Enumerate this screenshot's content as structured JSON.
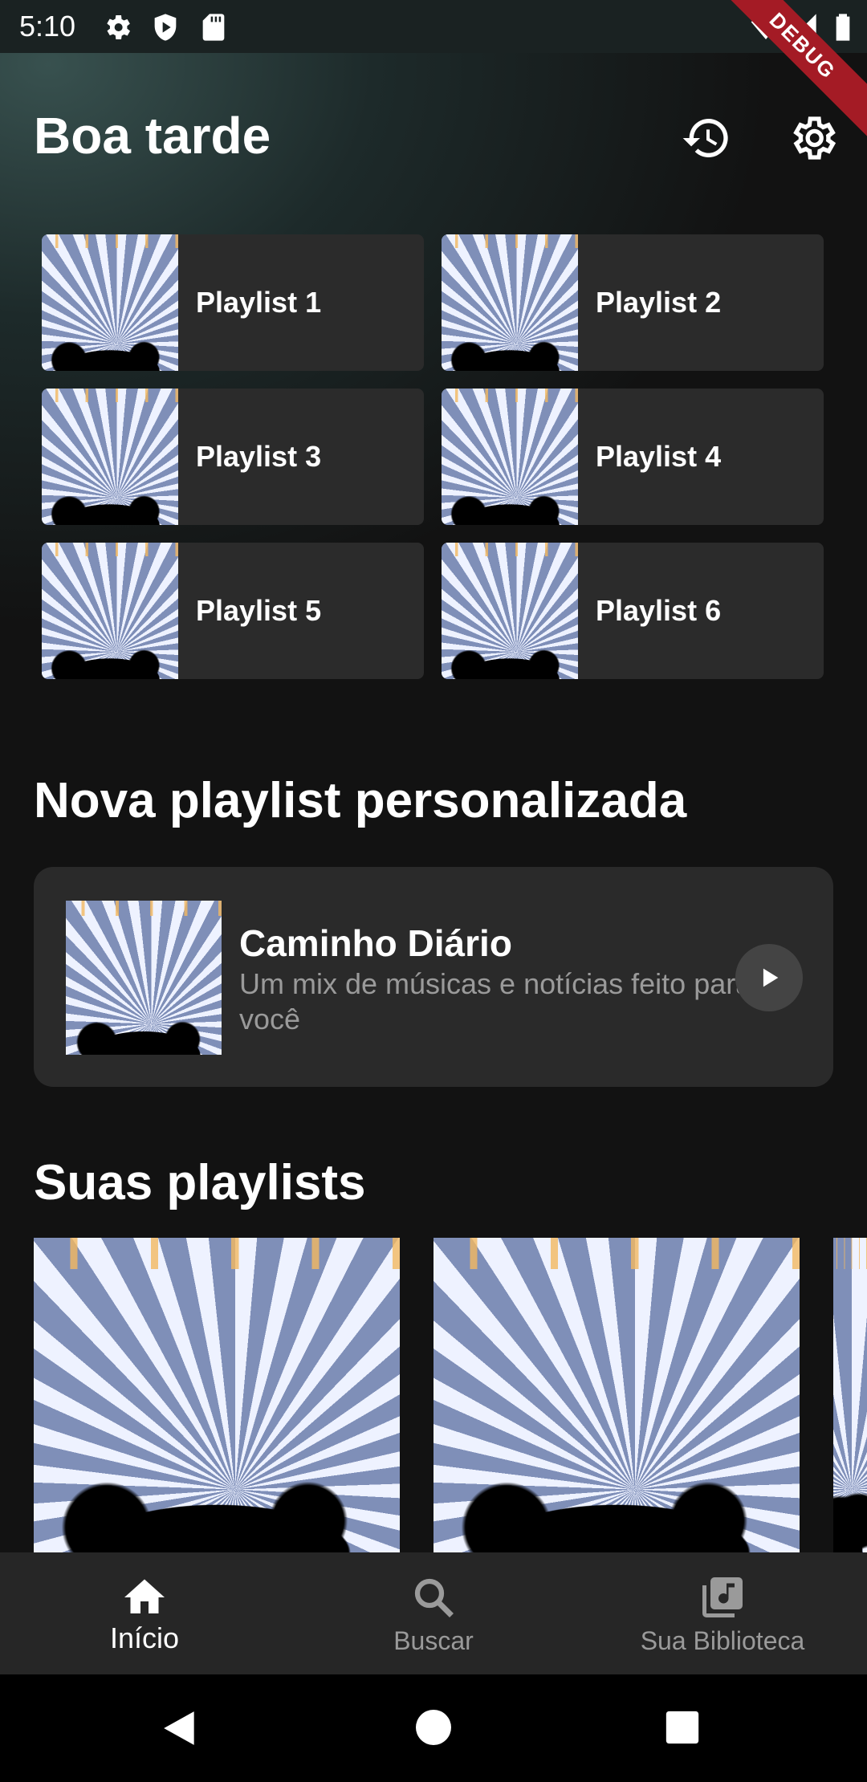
{
  "status_bar": {
    "time": "5:10",
    "debug": "DEBUG"
  },
  "header": {
    "greeting": "Boa tarde"
  },
  "playlists_grid": [
    {
      "title": "Playlist 1"
    },
    {
      "title": "Playlist 2"
    },
    {
      "title": "Playlist 3"
    },
    {
      "title": "Playlist 4"
    },
    {
      "title": "Playlist 5"
    },
    {
      "title": "Playlist 6"
    }
  ],
  "new_playlist": {
    "section_title": "Nova playlist personalizada",
    "card_title": "Caminho Diário",
    "card_subtitle": "Um mix de músicas e notícias feito para você"
  },
  "your_playlists": {
    "section_title": "Suas playlists"
  },
  "bottom_nav": {
    "home": "Início",
    "search": "Buscar",
    "library": "Sua Biblioteca"
  },
  "colors": {
    "background": "#121212",
    "card": "#2b2b2b",
    "nav": "#262626",
    "muted": "#9a9a9a"
  }
}
